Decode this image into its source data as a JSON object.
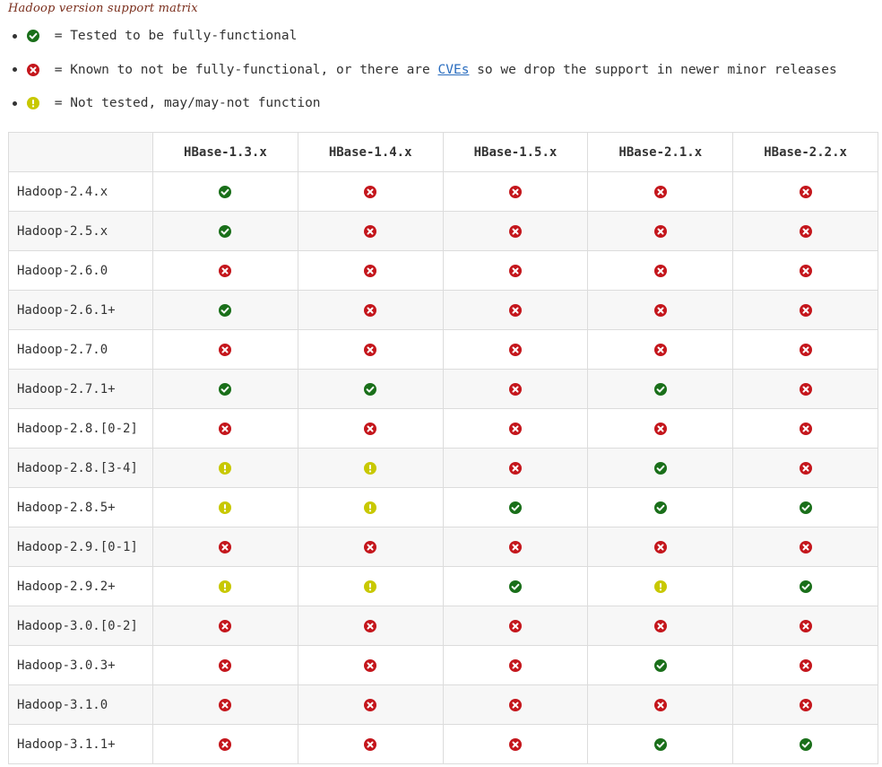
{
  "caption": "Hadoop version support matrix",
  "legend": [
    {
      "icon": "check-icon",
      "text": " = Tested to be fully-functional"
    },
    {
      "icon": "cross-icon",
      "text_before": " = Known to not be fully-functional, or there are ",
      "link": "CVEs",
      "text_after": " so we drop the support in newer minor releases"
    },
    {
      "icon": "warning-icon",
      "text": " = Not tested, may/may-not function"
    }
  ],
  "colors": {
    "check": "#1a6f1a",
    "cross": "#c4161c",
    "warning": "#c8c800"
  },
  "table": {
    "columns": [
      "HBase-1.3.x",
      "HBase-1.4.x",
      "HBase-1.5.x",
      "HBase-2.1.x",
      "HBase-2.2.x"
    ],
    "rows": [
      {
        "label": "Hadoop-2.4.x",
        "status": [
          "check",
          "cross",
          "cross",
          "cross",
          "cross"
        ]
      },
      {
        "label": "Hadoop-2.5.x",
        "status": [
          "check",
          "cross",
          "cross",
          "cross",
          "cross"
        ]
      },
      {
        "label": "Hadoop-2.6.0",
        "status": [
          "cross",
          "cross",
          "cross",
          "cross",
          "cross"
        ]
      },
      {
        "label": "Hadoop-2.6.1+",
        "status": [
          "check",
          "cross",
          "cross",
          "cross",
          "cross"
        ]
      },
      {
        "label": "Hadoop-2.7.0",
        "status": [
          "cross",
          "cross",
          "cross",
          "cross",
          "cross"
        ]
      },
      {
        "label": "Hadoop-2.7.1+",
        "status": [
          "check",
          "check",
          "cross",
          "check",
          "cross"
        ]
      },
      {
        "label": "Hadoop-2.8.[0-2]",
        "status": [
          "cross",
          "cross",
          "cross",
          "cross",
          "cross"
        ]
      },
      {
        "label": "Hadoop-2.8.[3-4]",
        "status": [
          "warning",
          "warning",
          "cross",
          "check",
          "cross"
        ]
      },
      {
        "label": "Hadoop-2.8.5+",
        "status": [
          "warning",
          "warning",
          "check",
          "check",
          "check"
        ]
      },
      {
        "label": "Hadoop-2.9.[0-1]",
        "status": [
          "cross",
          "cross",
          "cross",
          "cross",
          "cross"
        ]
      },
      {
        "label": "Hadoop-2.9.2+",
        "status": [
          "warning",
          "warning",
          "check",
          "warning",
          "check"
        ]
      },
      {
        "label": "Hadoop-3.0.[0-2]",
        "status": [
          "cross",
          "cross",
          "cross",
          "cross",
          "cross"
        ]
      },
      {
        "label": "Hadoop-3.0.3+",
        "status": [
          "cross",
          "cross",
          "cross",
          "check",
          "cross"
        ]
      },
      {
        "label": "Hadoop-3.1.0",
        "status": [
          "cross",
          "cross",
          "cross",
          "cross",
          "cross"
        ]
      },
      {
        "label": "Hadoop-3.1.1+",
        "status": [
          "cross",
          "cross",
          "cross",
          "check",
          "check"
        ]
      }
    ]
  }
}
